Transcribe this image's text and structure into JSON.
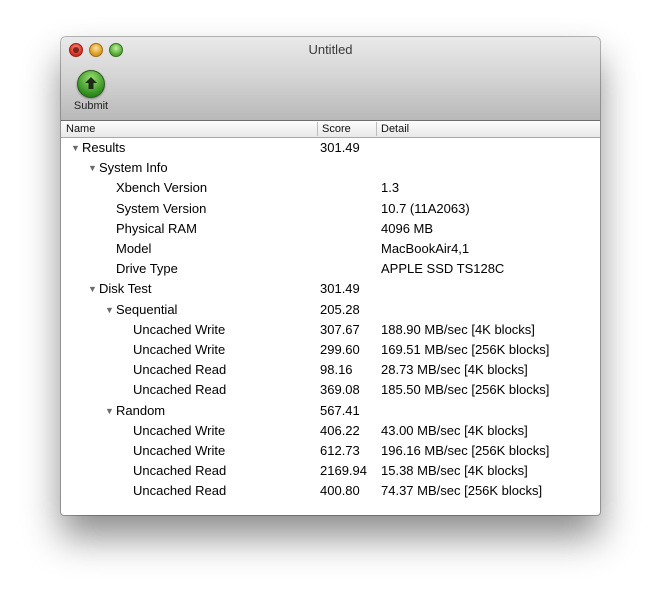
{
  "window": {
    "title": "Untitled"
  },
  "toolbar": {
    "submit_label": "Submit"
  },
  "table": {
    "columns": {
      "name": "Name",
      "score": "Score",
      "detail": "Detail"
    },
    "rows": [
      {
        "level": 0,
        "expandable": true,
        "name": "Results",
        "score": "301.49",
        "detail": ""
      },
      {
        "level": 1,
        "expandable": true,
        "name": "System Info",
        "score": "",
        "detail": ""
      },
      {
        "level": 2,
        "expandable": false,
        "name": "Xbench Version",
        "score": "",
        "detail": "1.3"
      },
      {
        "level": 2,
        "expandable": false,
        "name": "System Version",
        "score": "",
        "detail": "10.7 (11A2063)"
      },
      {
        "level": 2,
        "expandable": false,
        "name": "Physical RAM",
        "score": "",
        "detail": "4096 MB"
      },
      {
        "level": 2,
        "expandable": false,
        "name": "Model",
        "score": "",
        "detail": "MacBookAir4,1"
      },
      {
        "level": 2,
        "expandable": false,
        "name": "Drive Type",
        "score": "",
        "detail": "APPLE SSD TS128C"
      },
      {
        "level": 1,
        "expandable": true,
        "name": "Disk Test",
        "score": "301.49",
        "detail": ""
      },
      {
        "level": 2,
        "expandable": true,
        "name": "Sequential",
        "score": "205.28",
        "detail": ""
      },
      {
        "level": 3,
        "expandable": false,
        "name": "Uncached Write",
        "score": "307.67",
        "detail": "188.90 MB/sec [4K blocks]"
      },
      {
        "level": 3,
        "expandable": false,
        "name": "Uncached Write",
        "score": "299.60",
        "detail": "169.51 MB/sec [256K blocks]"
      },
      {
        "level": 3,
        "expandable": false,
        "name": "Uncached Read",
        "score": "98.16",
        "detail": "28.73 MB/sec [4K blocks]"
      },
      {
        "level": 3,
        "expandable": false,
        "name": "Uncached Read",
        "score": "369.08",
        "detail": "185.50 MB/sec [256K blocks]"
      },
      {
        "level": 2,
        "expandable": true,
        "name": "Random",
        "score": "567.41",
        "detail": ""
      },
      {
        "level": 3,
        "expandable": false,
        "name": "Uncached Write",
        "score": "406.22",
        "detail": "43.00 MB/sec [4K blocks]"
      },
      {
        "level": 3,
        "expandable": false,
        "name": "Uncached Write",
        "score": "612.73",
        "detail": "196.16 MB/sec [256K blocks]"
      },
      {
        "level": 3,
        "expandable": false,
        "name": "Uncached Read",
        "score": "2169.94",
        "detail": "15.38 MB/sec [4K blocks]"
      },
      {
        "level": 3,
        "expandable": false,
        "name": "Uncached Read",
        "score": "400.80",
        "detail": "74.37 MB/sec [256K blocks]"
      }
    ]
  },
  "colors": {
    "submit_green": "#2f8e1f",
    "close_red": "#d02a1c",
    "minimize_yellow": "#d8951b",
    "zoom_green": "#4fa22f"
  },
  "icons": {
    "submit": "green-up-arrow-icon",
    "disclosure": "disclosure-triangle-down-icon"
  }
}
